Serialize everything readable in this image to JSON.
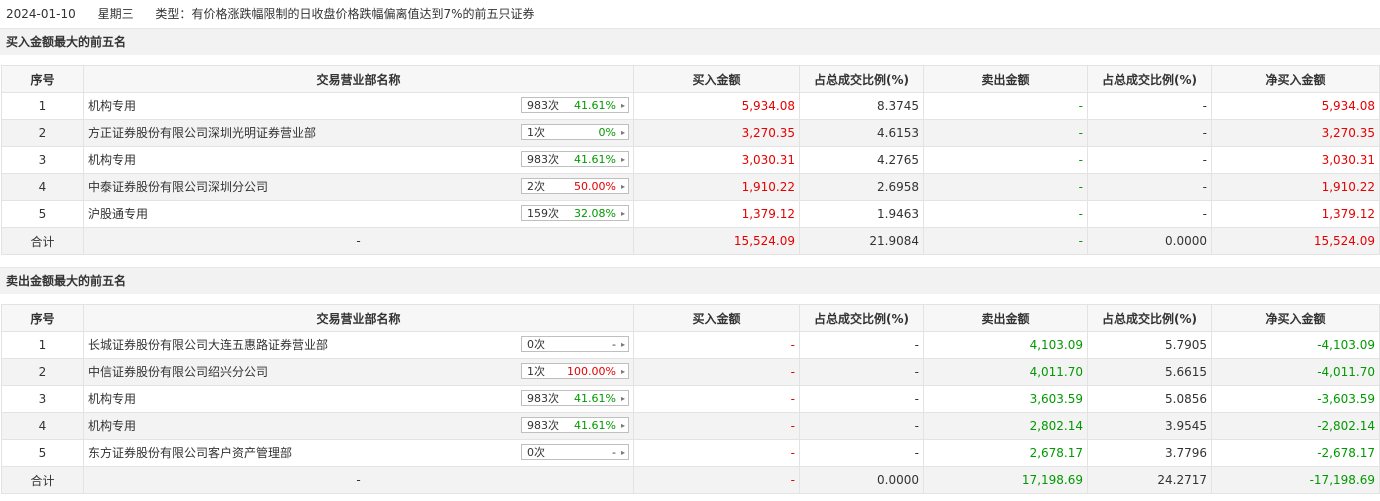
{
  "header": {
    "date": "2024-01-10",
    "weekday": "星期三",
    "type_label": "类型：",
    "type_text": "有价格涨跌幅限制的日收盘价格跌幅偏离值达到7%的前五只证券"
  },
  "buy_section": {
    "title": "买入金额最大的前五名",
    "columns": [
      "序号",
      "交易营业部名称",
      "买入金额",
      "占总成交比例(%)",
      "卖出金额",
      "占总成交比例(%)",
      "净买入金额"
    ],
    "rows": [
      {
        "no": "1",
        "name": "机构专用",
        "times": "983次",
        "pct": "41.61%",
        "pct_color": "green",
        "buy": "5,934.08",
        "buy_ratio": "8.3745",
        "sell": "-",
        "sell_ratio": "-",
        "net": "5,934.08",
        "net_color": "red"
      },
      {
        "no": "2",
        "name": "方正证券股份有限公司深圳光明证券营业部",
        "times": "1次",
        "pct": "0%",
        "pct_color": "green",
        "buy": "3,270.35",
        "buy_ratio": "4.6153",
        "sell": "-",
        "sell_ratio": "-",
        "net": "3,270.35",
        "net_color": "red"
      },
      {
        "no": "3",
        "name": "机构专用",
        "times": "983次",
        "pct": "41.61%",
        "pct_color": "green",
        "buy": "3,030.31",
        "buy_ratio": "4.2765",
        "sell": "-",
        "sell_ratio": "-",
        "net": "3,030.31",
        "net_color": "red"
      },
      {
        "no": "4",
        "name": "中泰证券股份有限公司深圳分公司",
        "times": "2次",
        "pct": "50.00%",
        "pct_color": "red",
        "buy": "1,910.22",
        "buy_ratio": "2.6958",
        "sell": "-",
        "sell_ratio": "-",
        "net": "1,910.22",
        "net_color": "red"
      },
      {
        "no": "5",
        "name": "沪股通专用",
        "times": "159次",
        "pct": "32.08%",
        "pct_color": "green",
        "buy": "1,379.12",
        "buy_ratio": "1.9463",
        "sell": "-",
        "sell_ratio": "-",
        "net": "1,379.12",
        "net_color": "red"
      }
    ],
    "total": {
      "label": "合计",
      "name": "-",
      "buy": "15,524.09",
      "buy_ratio": "21.9084",
      "sell": "-",
      "sell_ratio": "0.0000",
      "net": "15,524.09",
      "net_color": "red"
    }
  },
  "sell_section": {
    "title": "卖出金额最大的前五名",
    "columns": [
      "序号",
      "交易营业部名称",
      "买入金额",
      "占总成交比例(%)",
      "卖出金额",
      "占总成交比例(%)",
      "净买入金额"
    ],
    "rows": [
      {
        "no": "1",
        "name": "长城证券股份有限公司大连五惠路证券营业部",
        "times": "0次",
        "pct": "-",
        "pct_color": "gray",
        "buy": "-",
        "buy_ratio": "-",
        "sell": "4,103.09",
        "sell_ratio": "5.7905",
        "net": "-4,103.09",
        "net_color": "green"
      },
      {
        "no": "2",
        "name": "中信证券股份有限公司绍兴分公司",
        "times": "1次",
        "pct": "100.00%",
        "pct_color": "red",
        "buy": "-",
        "buy_ratio": "-",
        "sell": "4,011.70",
        "sell_ratio": "5.6615",
        "net": "-4,011.70",
        "net_color": "green"
      },
      {
        "no": "3",
        "name": "机构专用",
        "times": "983次",
        "pct": "41.61%",
        "pct_color": "green",
        "buy": "-",
        "buy_ratio": "-",
        "sell": "3,603.59",
        "sell_ratio": "5.0856",
        "net": "-3,603.59",
        "net_color": "green"
      },
      {
        "no": "4",
        "name": "机构专用",
        "times": "983次",
        "pct": "41.61%",
        "pct_color": "green",
        "buy": "-",
        "buy_ratio": "-",
        "sell": "2,802.14",
        "sell_ratio": "3.9545",
        "net": "-2,802.14",
        "net_color": "green"
      },
      {
        "no": "5",
        "name": "东方证券股份有限公司客户资产管理部",
        "times": "0次",
        "pct": "-",
        "pct_color": "gray",
        "buy": "-",
        "buy_ratio": "-",
        "sell": "2,678.17",
        "sell_ratio": "3.7796",
        "net": "-2,678.17",
        "net_color": "green"
      }
    ],
    "total": {
      "label": "合计",
      "name": "-",
      "buy": "-",
      "buy_ratio": "0.0000",
      "sell": "17,198.69",
      "sell_ratio": "24.2717",
      "net": "-17,198.69",
      "net_color": "green"
    }
  },
  "icons": {
    "badge_arrow": "caret-right-icon"
  },
  "colors": {
    "up": "#e60000",
    "down": "#009900",
    "header_bg": "#f7f7f7",
    "stripe": "#f3f3f3"
  }
}
